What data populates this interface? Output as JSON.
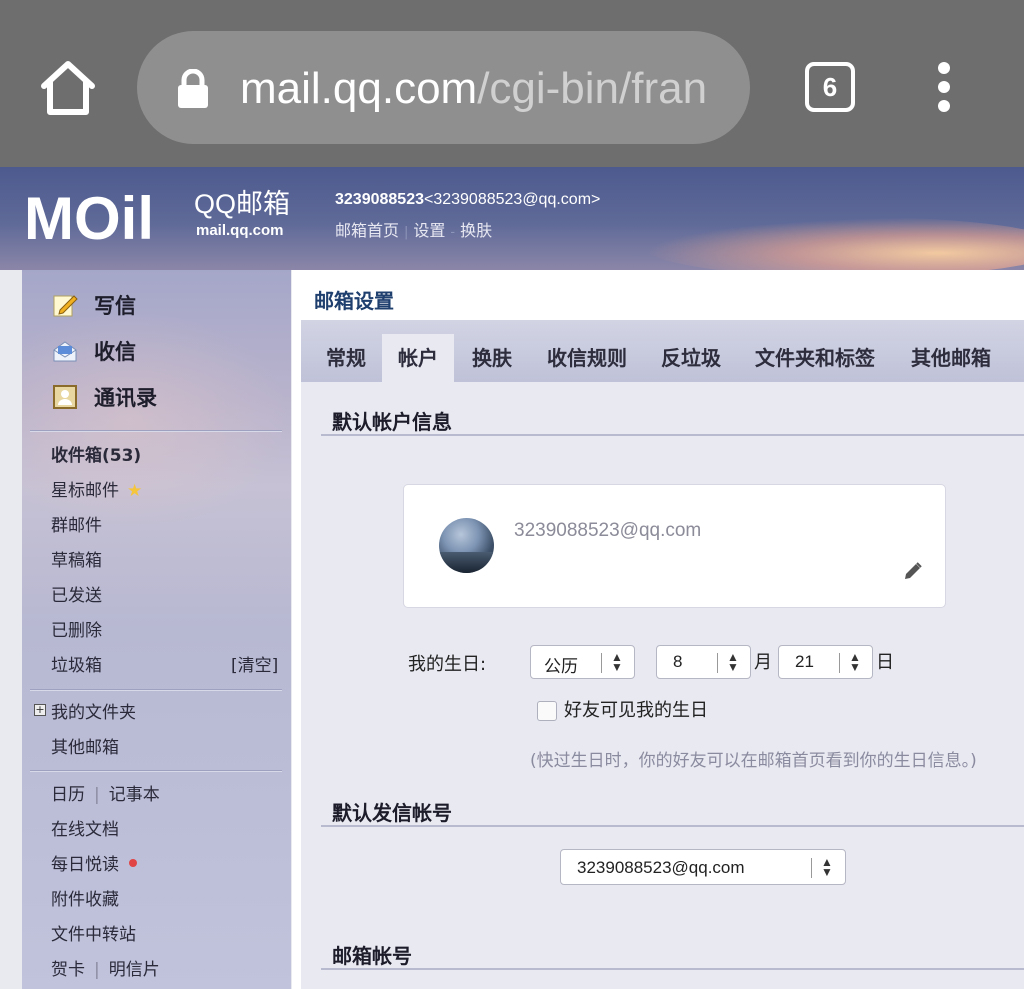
{
  "browser": {
    "url_host": "mail.qq.com",
    "url_path": "/cgi-bin/fran",
    "tab_count": "6"
  },
  "header": {
    "logo_text": "MOil",
    "logo_qq": "QQ邮箱",
    "logo_domain": "mail.qq.com",
    "account_id": "3239088523",
    "account_email": "<3239088523@qq.com>",
    "links": [
      "邮箱首页",
      "设置",
      "换肤"
    ]
  },
  "sidebar": {
    "quick": {
      "compose": "写信",
      "receive": "收信",
      "contacts": "通讯录"
    },
    "folders": {
      "inbox": "收件箱(53)",
      "starred": "星标邮件",
      "group": "群邮件",
      "drafts": "草稿箱",
      "sent": "已发送",
      "deleted": "已删除",
      "spam": "垃圾箱",
      "spam_clear": "[清空]"
    },
    "my_folders": "我的文件夹",
    "other_mailboxes": "其他邮箱",
    "tools": {
      "calendar": "日历",
      "notepad": "记事本",
      "online_docs": "在线文档",
      "daily_reading": "每日悦读",
      "attachments": "附件收藏",
      "file_transfer": "文件中转站",
      "greeting_card": "贺卡",
      "postcard": "明信片"
    }
  },
  "main": {
    "title": "邮箱设置",
    "tabs": [
      "常规",
      "帐户",
      "换肤",
      "收信规则",
      "反垃圾",
      "文件夹和标签",
      "其他邮箱"
    ],
    "active_tab": "帐户",
    "section_default_account": "默认帐户信息",
    "card_email": "3239088523@qq.com",
    "birthday_label": "我的生日:",
    "calendar_type": "公历",
    "month": "8",
    "month_unit": "月",
    "day": "21",
    "day_unit": "日",
    "friends_see_birthday": "好友可见我的生日",
    "birthday_hint": "(快过生日时，你的好友可以在邮箱首页看到你的生日信息。)",
    "section_default_sender": "默认发信帐号",
    "default_sender": "3239088523@qq.com",
    "section_mail_account": "邮箱帐号"
  }
}
